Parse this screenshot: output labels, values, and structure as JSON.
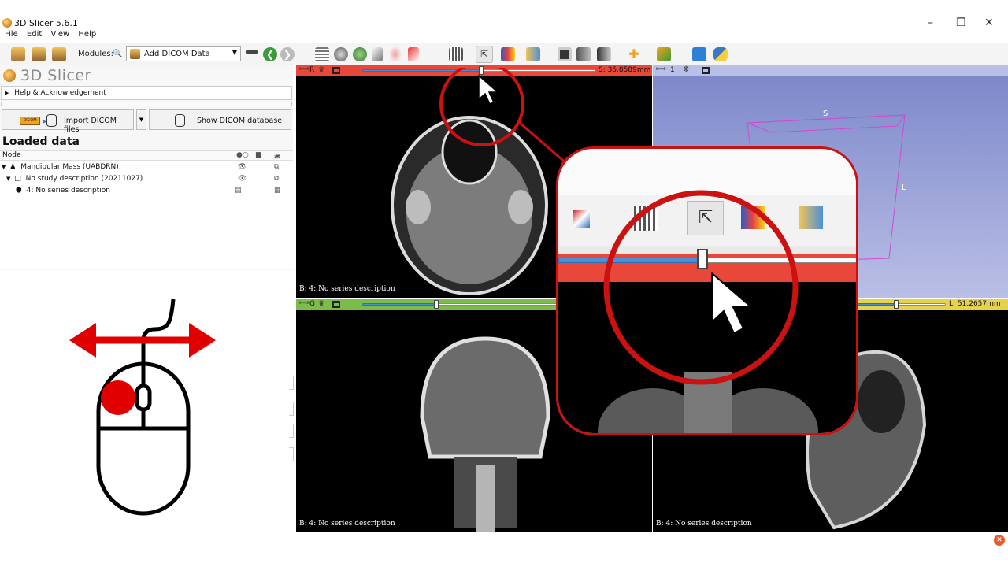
{
  "window": {
    "title": "3D Slicer 5.6.1"
  },
  "menu": [
    "File",
    "Edit",
    "View",
    "Help"
  ],
  "toolbar": {
    "modules_label": "Modules:",
    "module_selected": "Add DICOM Data"
  },
  "panel": {
    "title": "3D Slicer",
    "help_section": "Help & Acknowledgement",
    "import_button": "Import DICOM files",
    "show_db_button": "Show DICOM database",
    "loaded_heading": "Loaded data",
    "tree_header": "Node",
    "tree_rows": [
      {
        "label": "Mandibular Mass (UABDRN)"
      },
      {
        "label": "No study description (20211027)"
      },
      {
        "label": "4: No series description"
      }
    ]
  },
  "views": {
    "red": {
      "letter": "R",
      "readout": "S: 35.8589mm",
      "caption": "B: 4: No series description"
    },
    "threed": {
      "letter": "1",
      "orient_s": "S",
      "orient_l": "L"
    },
    "green": {
      "letter": "G",
      "caption": "B: 4: No series description"
    },
    "yellow": {
      "readout": "L: 51.2657mm",
      "caption": "B: 4: No series description"
    }
  },
  "colors": {
    "red_view": "#e8473a",
    "green_view": "#7cbd4a",
    "yellow_view": "#e6d34a",
    "threed_bg": "#7b86c9",
    "annotation_red": "#cc1111"
  },
  "annotation": {
    "mouse_button": "left-button",
    "gesture": "drag-horizontal"
  }
}
